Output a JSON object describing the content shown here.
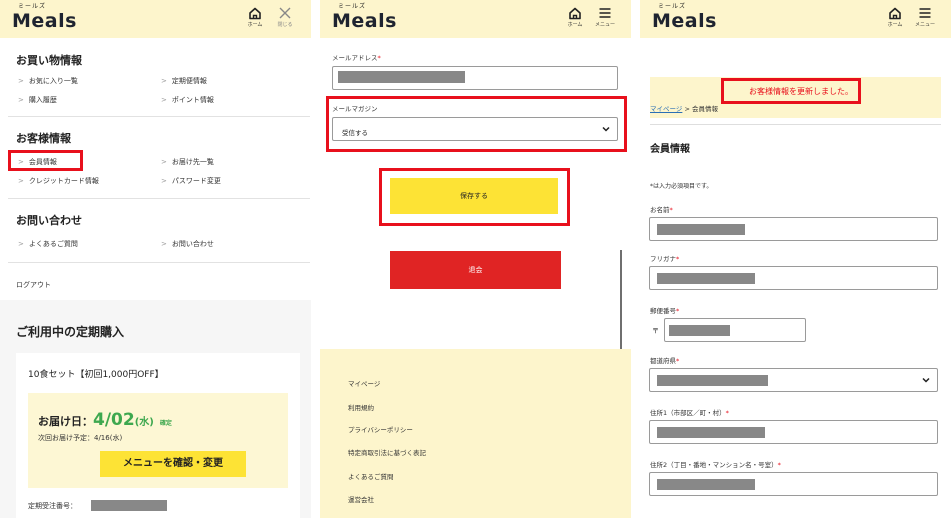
{
  "brand": {
    "logo_ruby": "ミールズ",
    "logo": "Meals"
  },
  "header": {
    "home_label": "ホーム",
    "close_label": "閉じる",
    "menu_label": "メニュー"
  },
  "panel1": {
    "shopping": {
      "title": "お買い物情報",
      "links": [
        "お気に入り一覧",
        "定期便情報",
        "購入履歴",
        "ポイント情報"
      ]
    },
    "customer": {
      "title": "お客様情報",
      "links": [
        "会員情報",
        "お届け先一覧",
        "クレジットカード情報",
        "パスワード変更"
      ]
    },
    "inquiry": {
      "title": "お問い合わせ",
      "links": [
        "よくあるご質問",
        "お問い合わせ"
      ]
    },
    "logout": "ログアウト",
    "subscription": {
      "title": "ご利用中の定期購入",
      "plan": "10食セット【初回1,000円OFF】",
      "delivery_label": "お届け日：",
      "delivery_date": "4/02",
      "delivery_dow": "(水)",
      "delivery_badge": "確定",
      "next_delivery": "次回お届け予定：4/16(水)",
      "menu_button": "メニューを確認・変更",
      "order_no_label": "定期受注番号："
    }
  },
  "panel2": {
    "email_label": "メールアドレス",
    "req_mark": "*",
    "magazine_label": "メールマガジン",
    "magazine_value": "受信する",
    "save_button": "保存する",
    "withdraw_button": "退会",
    "footer_links": [
      "マイページ",
      "利用規約",
      "プライバシーポリシー",
      "特定商取引法に基づく表記",
      "よくあるご質問",
      "運営会社"
    ]
  },
  "panel3": {
    "notice": "お客様情報を更新しました。",
    "breadcrumb_mypage": "マイページ",
    "breadcrumb_sep": ">",
    "breadcrumb_current": "会員情報",
    "title": "会員情報",
    "required_note": "*は入力必須項目です。",
    "req_mark": "*",
    "fields": {
      "name": "お名前",
      "kana": "フリガナ",
      "postal": "郵便番号",
      "prefecture": "都道府県",
      "address1": "住所1（市部区／町・村）",
      "address2": "住所2（丁目・番地・マンション名・号室）"
    },
    "postal_mark": "〒"
  },
  "colors": {
    "brand_yellow": "#fde335",
    "header_bg": "#fdf5cc",
    "highlight_red": "#e8101c",
    "withdraw_red": "#e02424",
    "delivery_green": "#3ea84f"
  },
  "icons": [
    "home-icon",
    "close-icon",
    "hamburger-icon",
    "chevron-down-icon"
  ]
}
